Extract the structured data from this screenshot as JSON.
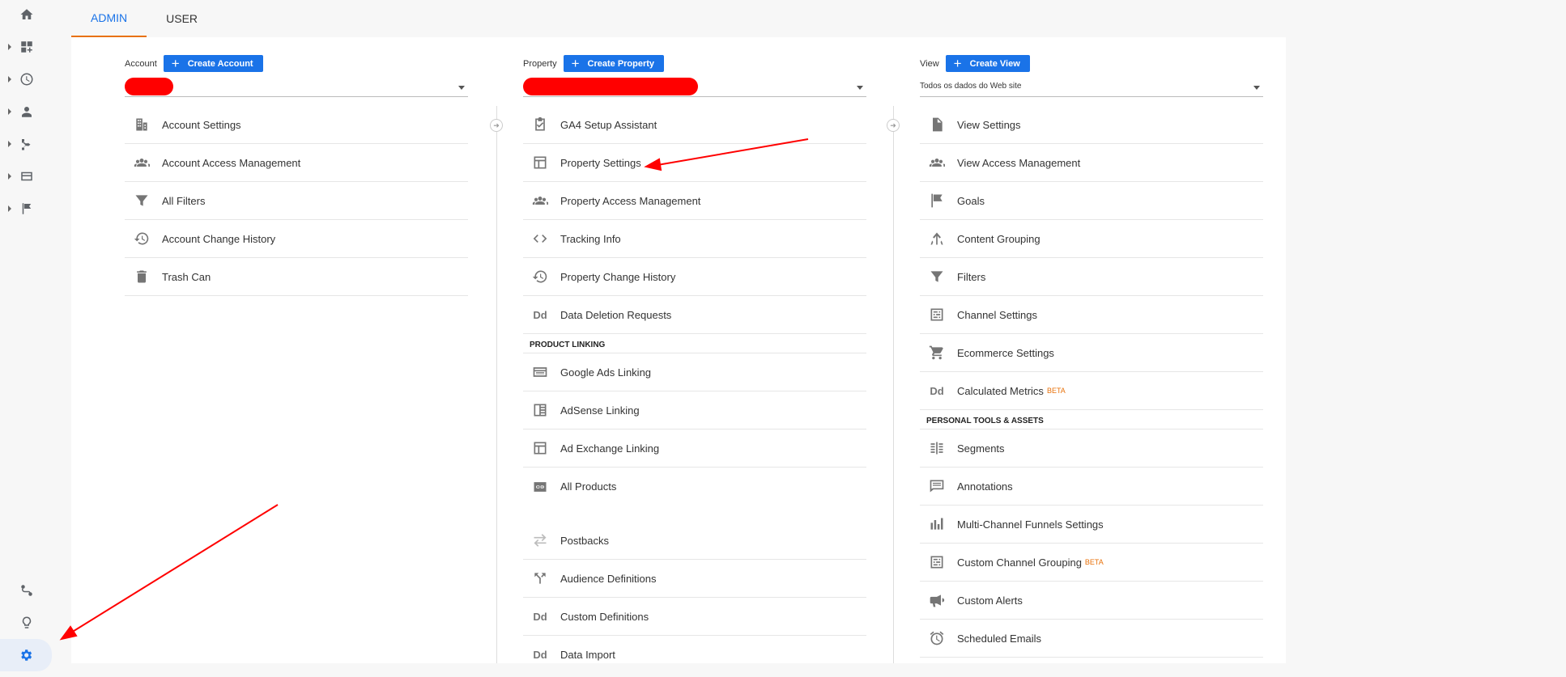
{
  "tabs": [
    {
      "label": "ADMIN"
    },
    {
      "label": "USER"
    }
  ],
  "account": {
    "label": "Account",
    "create_label": "Create Account",
    "items": [
      {
        "label": "Account Settings",
        "icon": "building-icon"
      },
      {
        "label": "Account Access Management",
        "icon": "people-icon"
      },
      {
        "label": "All Filters",
        "icon": "filter-icon"
      },
      {
        "label": "Account Change History",
        "icon": "history-icon"
      },
      {
        "label": "Trash Can",
        "icon": "trash-icon"
      }
    ]
  },
  "property": {
    "label": "Property",
    "create_label": "Create Property",
    "items": [
      {
        "label": "GA4 Setup Assistant",
        "icon": "clipboard-check-icon"
      },
      {
        "label": "Property Settings",
        "icon": "layout-icon"
      },
      {
        "label": "Property Access Management",
        "icon": "people-icon"
      },
      {
        "label": "Tracking Info",
        "icon": "code-icon"
      },
      {
        "label": "Property Change History",
        "icon": "history-icon"
      },
      {
        "label": "Data Deletion Requests",
        "icon": "dd-icon",
        "glyph": "Dd"
      }
    ],
    "section_label": "PRODUCT LINKING",
    "linking_items": [
      {
        "label": "Google Ads Linking",
        "icon": "ads-icon"
      },
      {
        "label": "AdSense Linking",
        "icon": "adsense-icon"
      },
      {
        "label": "Ad Exchange Linking",
        "icon": "layout-icon"
      },
      {
        "label": "All Products",
        "icon": "link-icon"
      }
    ],
    "more_items": [
      {
        "label": "Postbacks",
        "icon": "swap-icon"
      },
      {
        "label": "Audience Definitions",
        "icon": "fork-icon"
      },
      {
        "label": "Custom Definitions",
        "icon": "dd-icon",
        "glyph": "Dd"
      },
      {
        "label": "Data Import",
        "icon": "dd-icon",
        "glyph": "Dd"
      }
    ]
  },
  "view": {
    "label": "View",
    "create_label": "Create View",
    "selected": "Todos os dados do Web site",
    "items": [
      {
        "label": "View Settings",
        "icon": "document-icon"
      },
      {
        "label": "View Access Management",
        "icon": "people-icon"
      },
      {
        "label": "Goals",
        "icon": "flag-icon"
      },
      {
        "label": "Content Grouping",
        "icon": "grouping-icon"
      },
      {
        "label": "Filters",
        "icon": "filter-icon"
      },
      {
        "label": "Channel Settings",
        "icon": "channel-icon"
      },
      {
        "label": "Ecommerce Settings",
        "icon": "cart-icon"
      },
      {
        "label": "Calculated Metrics",
        "icon": "dd-icon",
        "glyph": "Dd",
        "badge": "BETA"
      }
    ],
    "section_label": "PERSONAL TOOLS & ASSETS",
    "tools_items": [
      {
        "label": "Segments",
        "icon": "segments-icon"
      },
      {
        "label": "Annotations",
        "icon": "comment-icon"
      },
      {
        "label": "Multi-Channel Funnels Settings",
        "icon": "bar-chart-icon"
      },
      {
        "label": "Custom Channel Grouping",
        "icon": "channel-icon",
        "badge": "BETA"
      },
      {
        "label": "Custom Alerts",
        "icon": "megaphone-icon"
      },
      {
        "label": "Scheduled Emails",
        "icon": "alarm-icon"
      }
    ]
  },
  "colors": {
    "accent": "#1a73e8",
    "tab_underline": "#e8710a",
    "annotation_arrow": "#ff0000",
    "redaction": "#ff0000"
  }
}
